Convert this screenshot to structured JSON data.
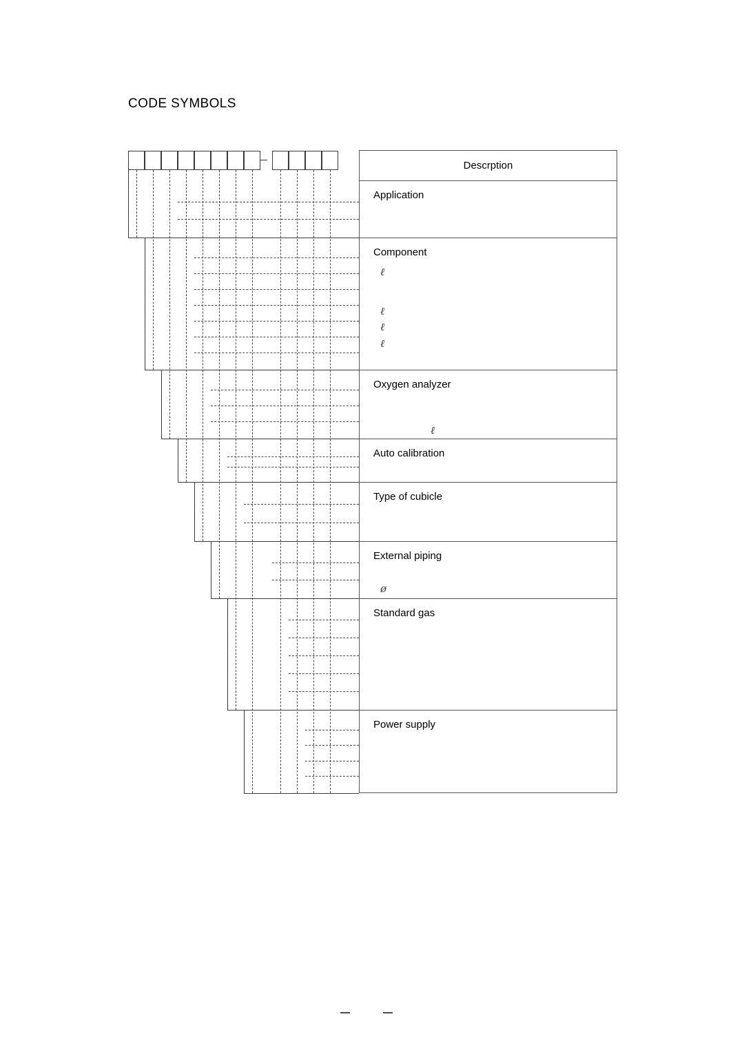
{
  "document": {
    "title": "CODE SYMBOLS"
  },
  "code_boxes": {
    "left_group_count": 8,
    "right_group_count": 4,
    "separator": "–",
    "left_cells": [
      "",
      "",
      "",
      "",
      "",
      "",
      "",
      ""
    ],
    "right_cells": [
      "",
      "",
      "",
      ""
    ]
  },
  "table": {
    "header": "Descrption",
    "rows": [
      {
        "label": "Application",
        "leader_count": 2,
        "units": []
      },
      {
        "label": "Component",
        "leader_count": 7,
        "units": [
          "ℓ",
          "ℓ",
          "ℓ",
          "ℓ"
        ]
      },
      {
        "label": "Oxygen analyzer",
        "leader_count": 3,
        "units": [
          "ℓ"
        ]
      },
      {
        "label": "Auto calibration",
        "leader_count": 2,
        "units": []
      },
      {
        "label": "Type of cubicle",
        "leader_count": 2,
        "units": []
      },
      {
        "label": "External piping",
        "leader_count": 2,
        "units": [
          "ø"
        ]
      },
      {
        "label": "Standard gas",
        "leader_count": 5,
        "units": []
      },
      {
        "label": "Power supply",
        "leader_count": 4,
        "units": []
      }
    ]
  },
  "footer": {
    "left_dash": "–",
    "right_dash": "–",
    "page_number": ""
  },
  "colors": {
    "ink": "#000000",
    "rule": "#3a3a3a",
    "table_rule": "#555555",
    "dash": "#4a4a4a",
    "paper": "#ffffff"
  }
}
